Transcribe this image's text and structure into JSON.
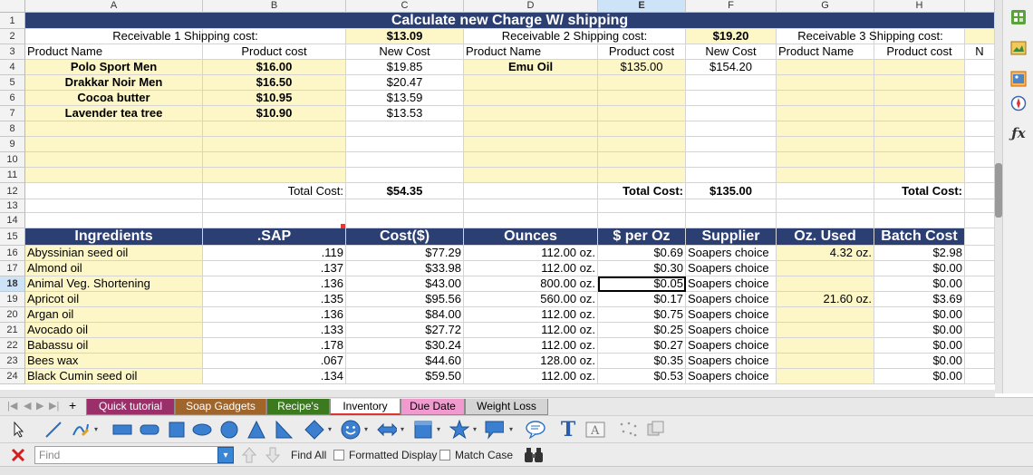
{
  "columns": [
    "A",
    "B",
    "C",
    "D",
    "E",
    "F",
    "G",
    "H"
  ],
  "rows": [
    "1",
    "2",
    "3",
    "4",
    "5",
    "6",
    "7",
    "8",
    "9",
    "10",
    "11",
    "12",
    "13",
    "14",
    "15",
    "16",
    "17",
    "18",
    "19",
    "20",
    "21",
    "22",
    "23",
    "24"
  ],
  "title": "Calculate new Charge W/ shipping",
  "shipping": {
    "r1_label": "Receivable 1 Shipping cost:",
    "r1_value": "$13.09",
    "r2_label": "Receivable 2 Shipping cost:",
    "r2_value": "$19.20",
    "r3_label": "Receivable 3 Shipping cost:"
  },
  "headers3": {
    "product_name": "Product Name",
    "product_cost": "Product cost",
    "new_cost": "New Cost",
    "product_name2": "Product Name",
    "product_cost2": "Product cost",
    "new_cost2": "New Cost",
    "product_name3": "Product Name",
    "product_cost3": "Product cost",
    "clipped": "N"
  },
  "products1": [
    {
      "name": "Polo Sport Men",
      "cost": "$16.00",
      "new_cost": "$19.85"
    },
    {
      "name": "Drakkar Noir Men",
      "cost": "$16.50",
      "new_cost": "$20.47"
    },
    {
      "name": "Cocoa butter",
      "cost": "$10.95",
      "new_cost": "$13.59"
    },
    {
      "name": "Lavender tea tree",
      "cost": "$10.90",
      "new_cost": "$13.53"
    }
  ],
  "products2": [
    {
      "name": "Emu Oil",
      "cost": "$135.00",
      "new_cost": "$154.20"
    }
  ],
  "totals": {
    "label1": "Total Cost:",
    "value1": "$54.35",
    "label2": "Total Cost:",
    "value2": "$135.00",
    "label3": "Total Cost:"
  },
  "ingredient_headers": [
    "Ingredients",
    ".SAP",
    "Cost($)",
    "Ounces",
    "$ per Oz",
    "Supplier",
    "Oz. Used",
    "Batch Cost"
  ],
  "ingredients": [
    {
      "name": "Abyssinian seed oil",
      "sap": ".119",
      "cost": "$77.29",
      "ounces": "112.00 oz.",
      "per_oz": "$0.69",
      "supplier": "Soapers choice",
      "used": "4.32 oz.",
      "batch": "$2.98"
    },
    {
      "name": "Almond oil",
      "sap": ".137",
      "cost": "$33.98",
      "ounces": "112.00 oz.",
      "per_oz": "$0.30",
      "supplier": "Soapers choice",
      "used": "",
      "batch": "$0.00"
    },
    {
      "name": "Animal Veg. Shortening",
      "sap": ".136",
      "cost": "$43.00",
      "ounces": "800.00 oz.",
      "per_oz": "$0.05",
      "supplier": "Soapers choice",
      "used": "",
      "batch": "$0.00"
    },
    {
      "name": "Apricot oil",
      "sap": ".135",
      "cost": "$95.56",
      "ounces": "560.00 oz.",
      "per_oz": "$0.17",
      "supplier": "Soapers choice",
      "used": "21.60 oz.",
      "batch": "$3.69"
    },
    {
      "name": "Argan oil",
      "sap": ".136",
      "cost": "$84.00",
      "ounces": "112.00 oz.",
      "per_oz": "$0.75",
      "supplier": "Soapers choice",
      "used": "",
      "batch": "$0.00"
    },
    {
      "name": "Avocado oil",
      "sap": ".133",
      "cost": "$27.72",
      "ounces": "112.00 oz.",
      "per_oz": "$0.25",
      "supplier": "Soapers choice",
      "used": "",
      "batch": "$0.00"
    },
    {
      "name": "Babassu oil",
      "sap": ".178",
      "cost": "$30.24",
      "ounces": "112.00 oz.",
      "per_oz": "$0.27",
      "supplier": "Soapers choice",
      "used": "",
      "batch": "$0.00"
    },
    {
      "name": "Bees wax",
      "sap": ".067",
      "cost": "$44.60",
      "ounces": "128.00 oz.",
      "per_oz": "$0.35",
      "supplier": "Soapers choice",
      "used": "",
      "batch": "$0.00"
    },
    {
      "name": "Black Cumin seed oil",
      "sap": ".134",
      "cost": "$59.50",
      "ounces": "112.00 oz.",
      "per_oz": "$0.53",
      "supplier": "Soapers choice",
      "used": "",
      "batch": "$0.00"
    }
  ],
  "sheet_tabs": [
    {
      "label": "Quick tutorial",
      "color": "#9b2f6a",
      "text": "#ffffff"
    },
    {
      "label": "Soap Gadgets",
      "color": "#a0652b",
      "text": "#ffffff"
    },
    {
      "label": "Recipe's",
      "color": "#3b7a1f",
      "text": "#ffffff"
    },
    {
      "label": "Inventory",
      "color": "#ffffff",
      "text": "#000000"
    },
    {
      "label": "Due Date",
      "color": "#f19ad0",
      "text": "#000000"
    },
    {
      "label": "Weight Loss",
      "color": "#d4d4d4",
      "text": "#000000"
    }
  ],
  "add_sheet": "+",
  "find": {
    "placeholder": "Find",
    "find_all": "Find All",
    "formatted_display": "Formatted Display",
    "match_case": "Match Case"
  },
  "colors": {
    "header_navy": "#2b3f73",
    "input_yellow": "#fdf6c7"
  }
}
